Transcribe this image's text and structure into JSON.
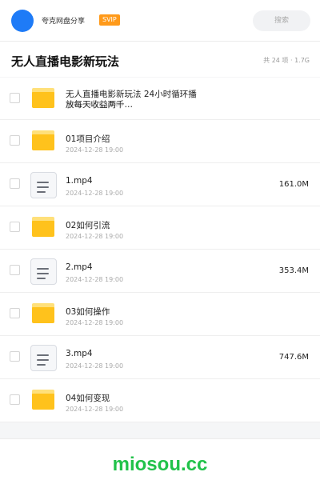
{
  "header": {
    "share_name": "夸克网盘分享",
    "badge": "SVIP",
    "search_label": "搜索"
  },
  "folder": {
    "title": "无人直播电影新玩法",
    "summary": "共 24 项 · 1.7G"
  },
  "items": [
    {
      "type": "folder",
      "icon": "folder-icon",
      "name": "无人直播电影新玩法 24小时循环播放每天收益两千…",
      "date": "2024-12-28 19:00",
      "size": ""
    },
    {
      "type": "folder",
      "icon": "folder-icon",
      "name": "01项目介绍",
      "date": "2024-12-28 19:00",
      "size": ""
    },
    {
      "type": "file",
      "icon": "video-file-icon",
      "name": "1.mp4",
      "date": "2024-12-28 19:00",
      "size": "161.0M"
    },
    {
      "type": "folder",
      "icon": "folder-icon",
      "name": "02如何引流",
      "date": "2024-12-28 19:00",
      "size": ""
    },
    {
      "type": "file",
      "icon": "video-file-icon",
      "name": "2.mp4",
      "date": "2024-12-28 19:00",
      "size": "353.4M"
    },
    {
      "type": "folder",
      "icon": "folder-icon",
      "name": "03如何操作",
      "date": "2024-12-28 19:00",
      "size": ""
    },
    {
      "type": "file",
      "icon": "video-file-icon",
      "name": "3.mp4",
      "date": "2024-12-28 19:00",
      "size": "747.6M"
    },
    {
      "type": "folder",
      "icon": "folder-icon",
      "name": "04如何变现",
      "date": "2024-12-28 19:00",
      "size": ""
    }
  ],
  "watermark": "miosou.cc",
  "colors": {
    "avatar": "#1e7bf7",
    "svip_badge": "#ff9a1a",
    "folder": "#ffc21c",
    "watermark": "#21c24a"
  }
}
